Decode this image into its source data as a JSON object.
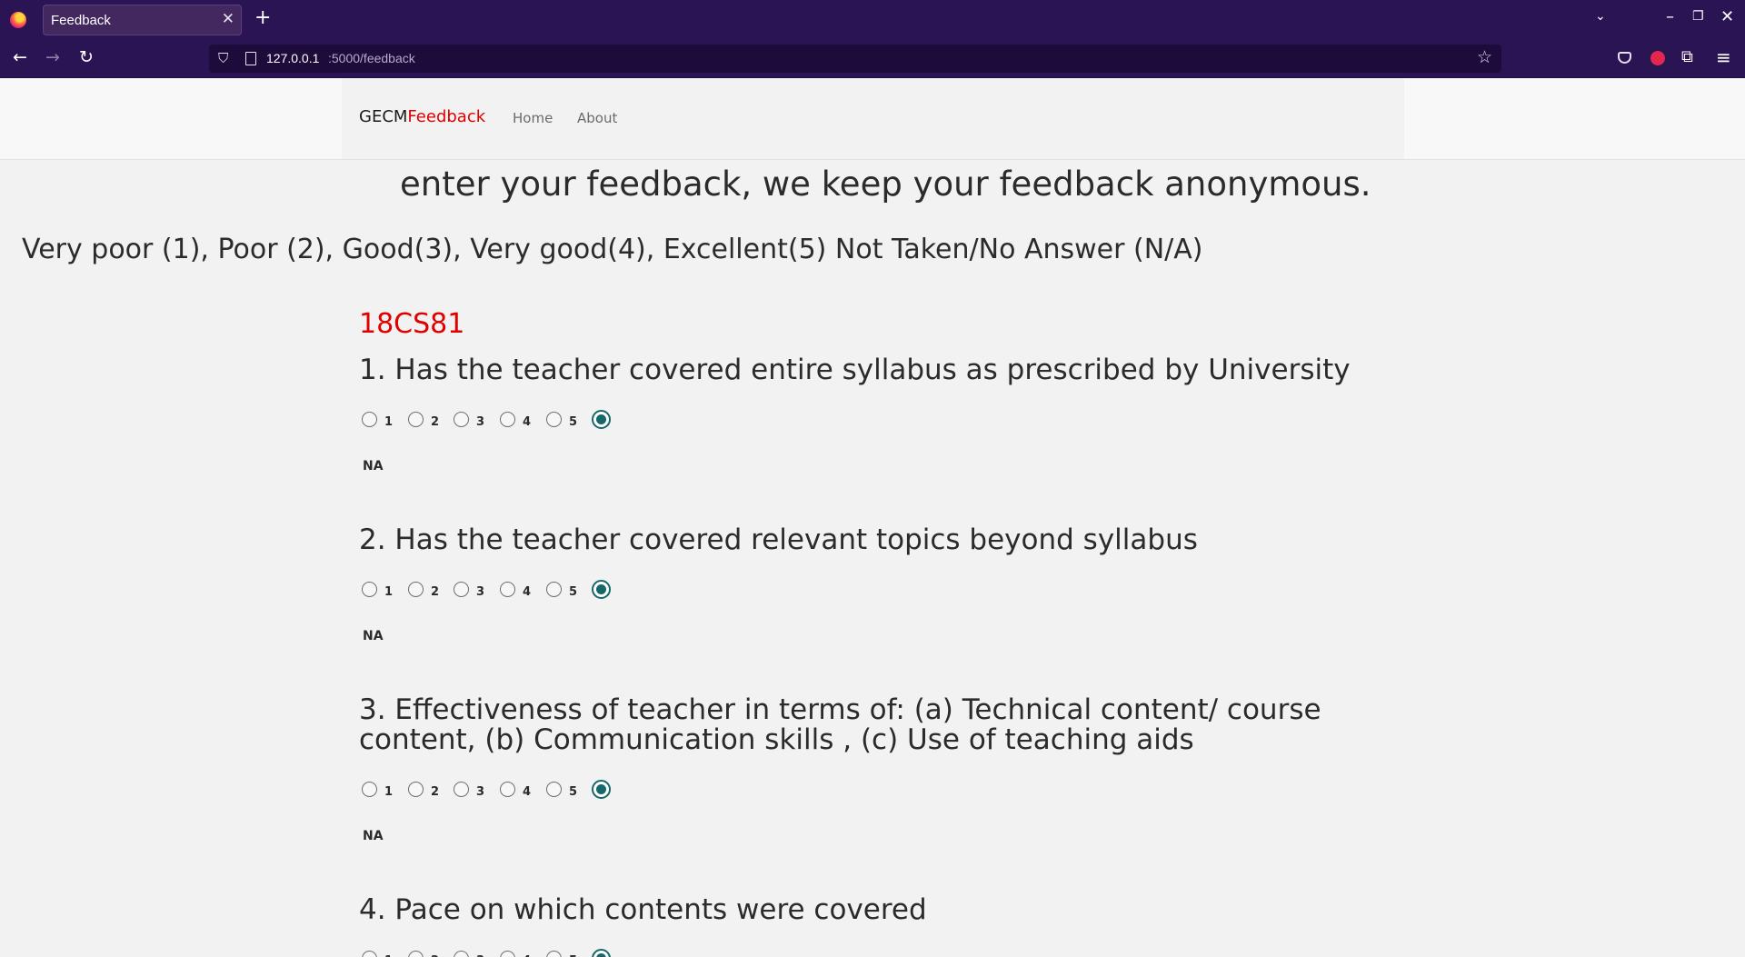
{
  "browser": {
    "tab_title": "Feedback",
    "url_host": "127.0.0.1",
    "url_path": ":5000/feedback"
  },
  "site": {
    "brand_main": "GECM",
    "brand_accent": "Feedback",
    "nav": [
      "Home",
      "About"
    ]
  },
  "intro_text": "enter your feedback, we keep your feedback anonymous.",
  "scale_legend": "Very poor (1), Poor (2), Good(3), Very good(4), Excellent(5) Not Taken/No Answer (N/A)",
  "course_code": "18CS81",
  "rating_options": [
    "1",
    "2",
    "3",
    "4",
    "5"
  ],
  "na_label": "NA",
  "questions": [
    {
      "text": "1. Has the teacher covered entire syllabus as prescribed by University",
      "selected": "NA"
    },
    {
      "text": "2. Has the teacher covered relevant topics beyond syllabus",
      "selected": "NA"
    },
    {
      "text": "3. Effectiveness of teacher in terms of: (a) Technical content/ course content, (b) Communication skills , (c) Use of teaching aids",
      "selected": "NA"
    },
    {
      "text": "4. Pace on which contents were covered",
      "selected": "NA"
    }
  ],
  "colors": {
    "accent_red": "#e00000",
    "radio_checked": "#17676a",
    "browser_chrome": "#2b1454"
  }
}
